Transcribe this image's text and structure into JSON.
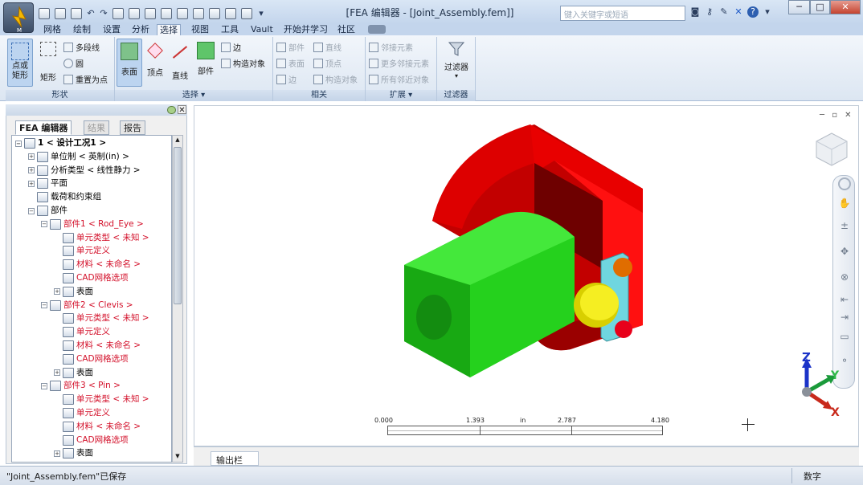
{
  "window": {
    "title": "[FEA 编辑器 - [Joint_Assembly.fem]]",
    "app_letter": "M",
    "search_placeholder": "键入关键字或短语",
    "min": "─",
    "max": "□",
    "close": "✕"
  },
  "menu_tabs": [
    "网格",
    "绘制",
    "设置",
    "分析",
    "选择",
    "视图",
    "工具",
    "Vault",
    "开始并学习",
    "社区"
  ],
  "ribbon": {
    "shape_panel": {
      "label": "形状",
      "point_rect": "点或矩形",
      "rect": "矩形",
      "polyline": "多段线",
      "circle": "圆",
      "reset": "重置为点"
    },
    "select_panel": {
      "label": "选择",
      "surface": "表面",
      "vertex": "顶点",
      "line": "直线",
      "part": "部件",
      "edge": "边",
      "construct": "构造对象"
    },
    "related_panel": {
      "label": "相关",
      "part": "部件",
      "line": "直线",
      "surface": "表面",
      "vertex": "顶点",
      "edge": "边",
      "construct": "构造对象"
    },
    "extend_panel": {
      "label": "扩展",
      "neighbor": "邻接元素",
      "more_neighbor": "更多邻接元素",
      "all_neighbor": "所有邻近对象"
    },
    "filter_panel": {
      "label": "过滤器",
      "filter": "过滤器"
    }
  },
  "browser": {
    "tabs": [
      "FEA 编辑器",
      "结果",
      "报告"
    ],
    "tree": [
      {
        "text": "1 < 设计工况1 >",
        "indent": 0,
        "pm": "−",
        "color": "#000",
        "bold": true
      },
      {
        "text": "单位制 < 英制(in) >",
        "indent": 1,
        "pm": "+",
        "color": "#000"
      },
      {
        "text": "分析类型 < 线性静力 >",
        "indent": 1,
        "pm": "+",
        "color": "#000"
      },
      {
        "text": "平面",
        "indent": 1,
        "pm": "+",
        "color": "#000"
      },
      {
        "text": "载荷和约束组",
        "indent": 1,
        "pm": "",
        "color": "#000"
      },
      {
        "text": "部件",
        "indent": 1,
        "pm": "−",
        "color": "#000"
      },
      {
        "text": "部件1 < Rod_Eye >",
        "indent": 2,
        "pm": "−",
        "color": "#d3102a"
      },
      {
        "text": "单元类型 < 未知 >",
        "indent": 3,
        "pm": "",
        "color": "#d3102a"
      },
      {
        "text": "单元定义",
        "indent": 3,
        "pm": "",
        "color": "#d3102a"
      },
      {
        "text": "材料 < 未命名 >",
        "indent": 3,
        "pm": "",
        "color": "#d3102a"
      },
      {
        "text": "CAD网格选项",
        "indent": 3,
        "pm": "",
        "color": "#d3102a"
      },
      {
        "text": "表面",
        "indent": 3,
        "pm": "+",
        "color": "#000"
      },
      {
        "text": "部件2 < Clevis >",
        "indent": 2,
        "pm": "−",
        "color": "#d3102a"
      },
      {
        "text": "单元类型 < 未知 >",
        "indent": 3,
        "pm": "",
        "color": "#d3102a"
      },
      {
        "text": "单元定义",
        "indent": 3,
        "pm": "",
        "color": "#d3102a"
      },
      {
        "text": "材料 < 未命名 >",
        "indent": 3,
        "pm": "",
        "color": "#d3102a"
      },
      {
        "text": "CAD网格选项",
        "indent": 3,
        "pm": "",
        "color": "#d3102a"
      },
      {
        "text": "表面",
        "indent": 3,
        "pm": "+",
        "color": "#000"
      },
      {
        "text": "部件3 < Pin >",
        "indent": 2,
        "pm": "−",
        "color": "#d3102a"
      },
      {
        "text": "单元类型 < 未知 >",
        "indent": 3,
        "pm": "",
        "color": "#d3102a"
      },
      {
        "text": "单元定义",
        "indent": 3,
        "pm": "",
        "color": "#d3102a"
      },
      {
        "text": "材料 < 未命名 >",
        "indent": 3,
        "pm": "",
        "color": "#d3102a"
      },
      {
        "text": "CAD网格选项",
        "indent": 3,
        "pm": "",
        "color": "#d3102a"
      },
      {
        "text": "表面",
        "indent": 3,
        "pm": "+",
        "color": "#000"
      }
    ]
  },
  "scale": {
    "t0": "0.000",
    "t1": "1.393",
    "unit": "in",
    "t2": "2.787",
    "t3": "4.180"
  },
  "triad": {
    "z": "Z",
    "y": "Y",
    "x": "X"
  },
  "output_tab": "输出栏",
  "status": {
    "message": "\"Joint_Assembly.fem\"已保存",
    "mode": "数字"
  },
  "colors": {
    "clevis": "#e00000",
    "rod": "#22d41c",
    "pin_head": "#f0e820",
    "plate": "#6fd6df"
  }
}
